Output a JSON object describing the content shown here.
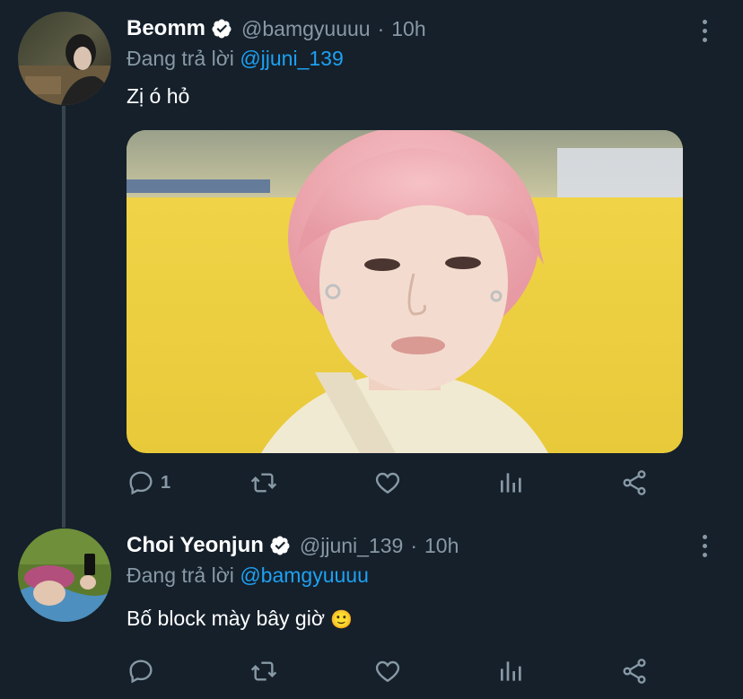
{
  "tweets": [
    {
      "name": "Beomm",
      "handle": "@bamgyuuuu",
      "dot": "·",
      "time": "10h",
      "reply_prefix": "Đang trả lời ",
      "reply_to": "@jjuni_139",
      "text": "Zị ó hỏ",
      "reply_count": "1"
    },
    {
      "name": "Choi Yeonjun",
      "handle": "@jjuni_139",
      "dot": "·",
      "time": "10h",
      "reply_prefix": "Đang trả lời ",
      "reply_to": "@bamgyuuuu",
      "text": "Bố block mày bây giờ",
      "emoji": "🙂",
      "reply_count": ""
    }
  ],
  "colors": {
    "background": "#15202b",
    "secondary_text": "#8899a6",
    "mention": "#1da1f2",
    "thread_line": "#38444d"
  },
  "icons": [
    "verified-badge-icon",
    "more-options-icon",
    "reply-icon",
    "retweet-icon",
    "like-icon",
    "analytics-icon",
    "share-icon"
  ]
}
